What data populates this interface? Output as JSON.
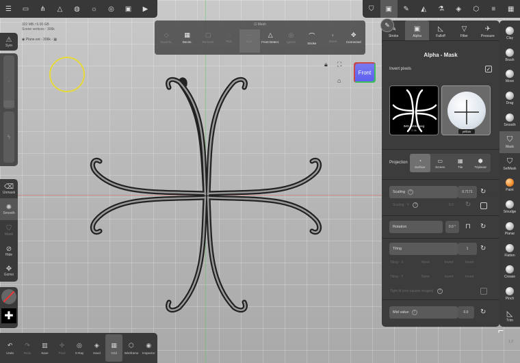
{
  "topbar_left": {
    "icons": [
      "menu-icon",
      "folder-icon",
      "share-icon",
      "scene-icon",
      "globe-icon",
      "sun-icon",
      "camera-settings-icon",
      "image-icon",
      "video-icon"
    ]
  },
  "topbar_right": {
    "icons": [
      "mask-tool-icon",
      "picture-icon",
      "brush-icon",
      "material-icon",
      "flask-icon",
      "layers-icon",
      "cube-icon",
      "sliders-icon",
      "grid-icon"
    ]
  },
  "stats": {
    "line1": "322 MB / 6.00 GB",
    "line2": "Scene vertices : 306k"
  },
  "plane": {
    "label": "Plane.ext - 306k - ▦"
  },
  "mesh_popup": {
    "title": "Mesh",
    "tools": [
      {
        "label": "Voxel M..",
        "glyph": "◇",
        "state": "dim"
      },
      {
        "label": "Decim.",
        "glyph": "▦",
        "state": "on"
      },
      {
        "label": "Remesh",
        "glyph": "▢",
        "state": "dim"
      },
      {
        "label": "Pick",
        "glyph": "◌",
        "state": "dim"
      },
      {
        "label": "Dyn.",
        "glyph": "···",
        "state": "sel"
      },
      {
        "label": "Front Detect.",
        "glyph": "△",
        "state": "on"
      },
      {
        "label": "Ignore",
        "glyph": "◎",
        "state": "dim"
      },
      {
        "label": "Stroke",
        "glyph": "⌒",
        "state": "on"
      },
      {
        "label": "Sheet",
        "glyph": "◗",
        "state": "dim"
      },
      {
        "label": "Connected",
        "glyph": "✥",
        "state": "on"
      }
    ]
  },
  "left_tools": {
    "sym_label": "Sym",
    "unmask_label": "Unmask",
    "smooth_label": "Smooth",
    "mask_label": "Mask",
    "hide_label": "Hide",
    "gizmo_label": "Gizmo"
  },
  "bottom_bar": {
    "tools": [
      {
        "label": "Undo",
        "glyph": "↶",
        "state": "on"
      },
      {
        "label": "Redo",
        "glyph": "↷",
        "state": "dim"
      },
      {
        "label": "Save",
        "glyph": "▥",
        "state": "on"
      },
      {
        "label": "Pivot",
        "glyph": "✢",
        "state": "dim"
      },
      {
        "label": "X-Ray",
        "glyph": "◎",
        "state": "on"
      },
      {
        "label": "Voxel",
        "glyph": "◈",
        "state": "on"
      },
      {
        "label": "Grid",
        "glyph": "▦",
        "state": "sel"
      },
      {
        "label": "Wireframe",
        "glyph": "⬡",
        "state": "on"
      },
      {
        "label": "Inspector",
        "glyph": "◉",
        "state": "on"
      }
    ]
  },
  "view_cube": {
    "label": "Front"
  },
  "brush_panel": {
    "tabs": [
      {
        "label": "Stroke",
        "glyph": "✎"
      },
      {
        "label": "Alpha",
        "glyph": "▣"
      },
      {
        "label": "Falloff",
        "glyph": "◺"
      },
      {
        "label": "Filter",
        "glyph": "▽"
      },
      {
        "label": "Pressure",
        "glyph": "✈"
      }
    ],
    "selected_tab": "Alpha",
    "title": "Alpha - Mask",
    "invert_label": "Invert pixels",
    "invert_checked": true,
    "alpha_thumb": {
      "name": "IMG_3494.jpeg",
      "size": "2.3k"
    },
    "material_thumb": {
      "name": "yellow"
    },
    "projection_label": "Projection",
    "projection_options": [
      {
        "label": "Surface",
        "glyph": "◔"
      },
      {
        "label": "Screen",
        "glyph": "▭"
      },
      {
        "label": "Tile",
        "glyph": "▦"
      },
      {
        "label": "Triplanar",
        "glyph": "⬢"
      }
    ],
    "projection_selected": "Surface",
    "scaling_label": "Scaling",
    "scaling_value": "0.7171",
    "scaling_y_label": "Scaling - Y",
    "scaling_y_value": "5.0",
    "rotation_label": "Rotation",
    "rotation_value": "0.0 °",
    "tiling_label": "Tiling",
    "tiling_value": "1",
    "tiling_x_label": "Tiling - X",
    "tiling_x_value1": "None",
    "tiling_x_value2": "Invert",
    "tiling_x_value3": "Invert",
    "tiling_y_label": "Tiling - Y",
    "tiling_y_value1": "None",
    "tiling_y_value2": "Invert",
    "tiling_y_value3": "Invert",
    "tight_label": "Tight fit (non square images)",
    "mid_label": "Mid value",
    "mid_value": "0.0"
  },
  "right_tools": [
    {
      "label": "Clay",
      "type": "ball"
    },
    {
      "label": "Brush",
      "type": "ball"
    },
    {
      "label": "Move",
      "type": "ball"
    },
    {
      "label": "Drag",
      "type": "ball"
    },
    {
      "label": "Smooth",
      "type": "ball"
    },
    {
      "label": "Mask",
      "type": "shield",
      "selected": true
    },
    {
      "label": "SelMask",
      "type": "shield"
    },
    {
      "label": "Paint",
      "type": "paint"
    },
    {
      "label": "Smudge",
      "type": "ball"
    },
    {
      "label": "Planar",
      "type": "ball"
    },
    {
      "label": "Flatten",
      "type": "ball"
    },
    {
      "label": "Crease",
      "type": "ball"
    },
    {
      "label": "Pinch",
      "type": "ball"
    },
    {
      "label": "Trim",
      "type": "trim"
    }
  ],
  "version": "1.2",
  "colors": {
    "cursor": "#e6da3a",
    "front_cube": "#6a6bf0",
    "panel": "#383838"
  }
}
